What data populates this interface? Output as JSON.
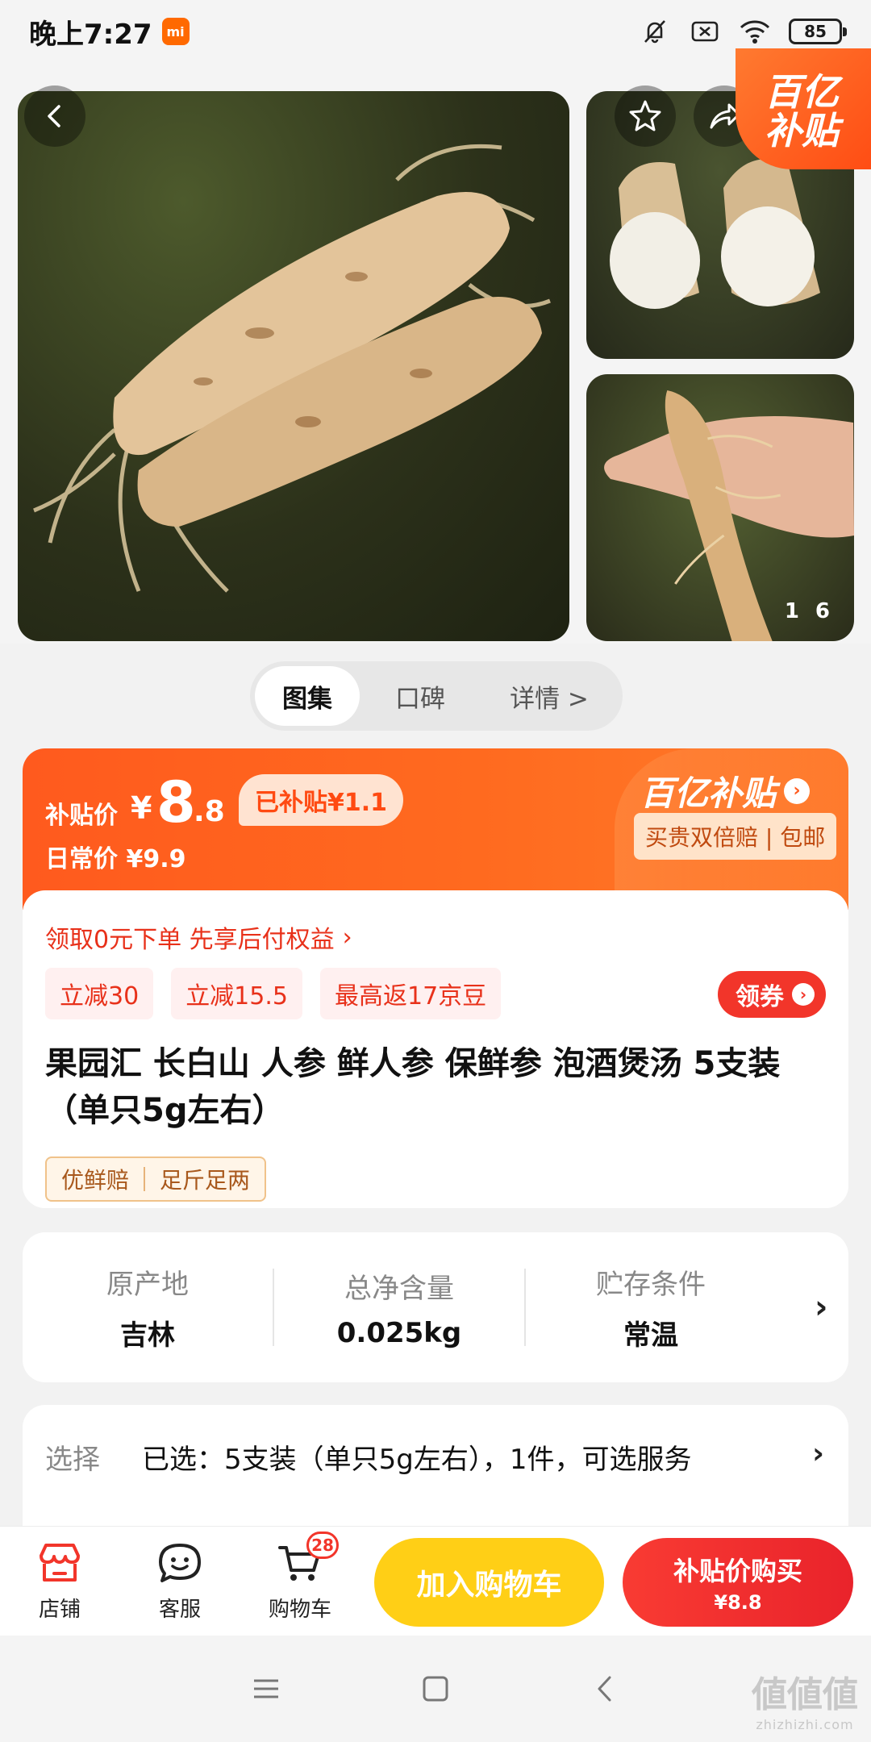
{
  "status_bar": {
    "time": "晚上7:27",
    "mi_badge": "mi",
    "battery": "85"
  },
  "gallery": {
    "corner_badge_line1": "百亿",
    "corner_badge_line2": "补贴",
    "counter_left": "1",
    "counter_right": "6"
  },
  "tabs": {
    "gallery": "图集",
    "reviews": "口碑",
    "details": "详情 >"
  },
  "price": {
    "label": "补贴价",
    "currency": "¥",
    "integer": "8",
    "decimal": ".8",
    "saved_tag": "已补贴¥1.1",
    "daily": "日常价 ¥9.9",
    "brand": "百亿补贴",
    "brand_arrow": "›",
    "brand_sub": "买贵双倍赔 | 包邮"
  },
  "promo": {
    "pay_later": "领取0元下单 先享后付权益",
    "pay_later_arrow": "›",
    "coupons": [
      "立减30",
      "立减15.5",
      "最高返17京豆"
    ],
    "get_coupon": "领券",
    "get_coupon_arrow": "›"
  },
  "product": {
    "title": "果园汇 长白山 人参 鲜人参 保鲜参 泡酒煲汤 5支装（单只5g左右）",
    "tags": [
      "优鲜赔",
      "足斤足两"
    ]
  },
  "specs": [
    {
      "key": "原产地",
      "value": "吉林"
    },
    {
      "key": "总净含量",
      "value": "0.025kg"
    },
    {
      "key": "贮存条件",
      "value": "常温"
    }
  ],
  "specs_arrow": "›",
  "selection": {
    "label": "选择",
    "value": "已选：5支装（单只5g左右），1件，可选服务",
    "arrow": "›"
  },
  "bottom_bar": {
    "shop": "店铺",
    "service": "客服",
    "cart": "购物车",
    "cart_count": "28",
    "add_to_cart": "加入购物车",
    "buy_line1": "补贴价购买",
    "buy_line2": "¥8.8"
  },
  "watermark": {
    "main": "値値値",
    "sub": "zhizhizhi.com"
  },
  "colors": {
    "accent_orange": "#ff5a1e",
    "accent_red": "#f2352a",
    "cart_yellow": "#ffcf16"
  }
}
